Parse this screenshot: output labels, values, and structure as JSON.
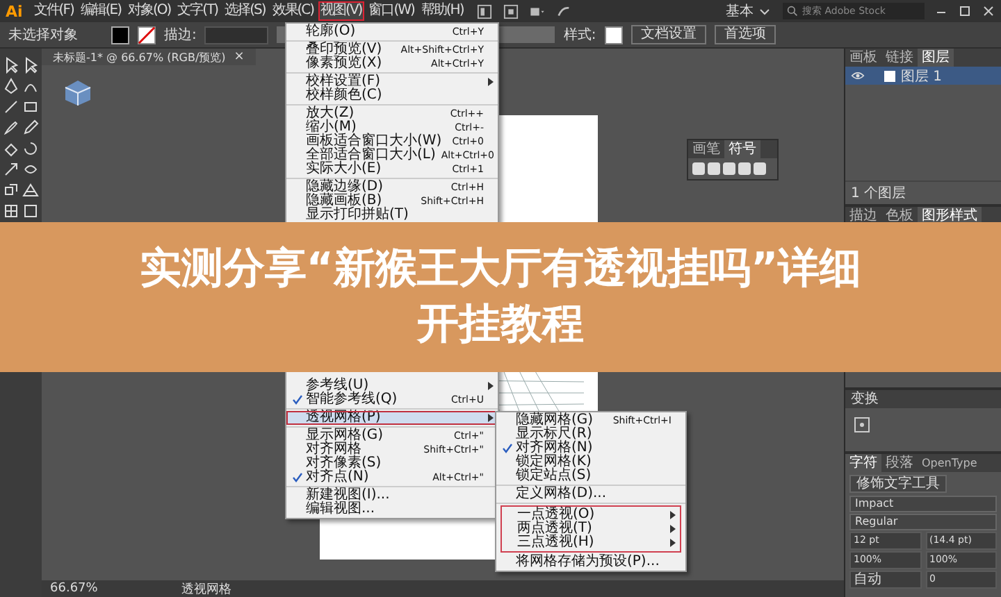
{
  "app": {
    "logo": "Ai"
  },
  "menubar": {
    "items": [
      {
        "label": "文件(F)",
        "selected": false
      },
      {
        "label": "编辑(E)",
        "selected": false
      },
      {
        "label": "对象(O)",
        "selected": false
      },
      {
        "label": "文字(T)",
        "selected": false
      },
      {
        "label": "选择(S)",
        "selected": false
      },
      {
        "label": "效果(C)",
        "selected": false
      },
      {
        "label": "视图(V)",
        "selected": true
      },
      {
        "label": "窗口(W)",
        "selected": false
      },
      {
        "label": "帮助(H)",
        "selected": false
      }
    ],
    "workspace": "基本",
    "search": {
      "placeholder": "搜索 Adobe Stock"
    }
  },
  "control_bar": {
    "selection": "未选择对象",
    "stroke_label": "描边:",
    "style_label": "样式:",
    "buttons": [
      "文档设置",
      "首选项"
    ]
  },
  "document_tab": {
    "title": "未标题-1* @ 66.67% (RGB/预览)",
    "close": "×"
  },
  "view_menu": {
    "top_groups": [
      {
        "items": [
          {
            "label": "轮廓(O)",
            "shortcut": "Ctrl+Y",
            "submenu": false,
            "checked": false,
            "selected": false
          }
        ]
      },
      {
        "items": [
          {
            "label": "叠印预览(V)",
            "shortcut": "Alt+Shift+Ctrl+Y",
            "submenu": false,
            "checked": false,
            "selected": false
          },
          {
            "label": "像素预览(X)",
            "shortcut": "Alt+Ctrl+Y",
            "submenu": false,
            "checked": false,
            "selected": false
          }
        ]
      },
      {
        "items": [
          {
            "label": "校样设置(F)",
            "submenu": true,
            "checked": false,
            "selected": false
          },
          {
            "label": "校样颜色(C)",
            "submenu": false,
            "checked": false,
            "selected": false
          }
        ]
      },
      {
        "items": [
          {
            "label": "放大(Z)",
            "shortcut": "Ctrl++",
            "submenu": false,
            "checked": false,
            "selected": false
          },
          {
            "label": "缩小(M)",
            "shortcut": "Ctrl+-",
            "submenu": false,
            "checked": false,
            "selected": false
          },
          {
            "label": "画板适合窗口大小(W)",
            "shortcut": "Ctrl+0",
            "submenu": false,
            "checked": false,
            "selected": false
          },
          {
            "label": "全部适合窗口大小(L)",
            "shortcut": "Alt+Ctrl+0",
            "submenu": false,
            "checked": false,
            "selected": false
          },
          {
            "label": "实际大小(E)",
            "shortcut": "Ctrl+1",
            "submenu": false,
            "checked": false,
            "selected": false
          }
        ]
      },
      {
        "items": [
          {
            "label": "隐藏边缘(D)",
            "shortcut": "Ctrl+H",
            "submenu": false,
            "checked": false,
            "selected": false
          },
          {
            "label": "隐藏画板(B)",
            "shortcut": "Shift+Ctrl+H",
            "submenu": false,
            "checked": false,
            "selected": false
          },
          {
            "label": "显示打印拼贴(T)",
            "submenu": false,
            "checked": false,
            "selected": false
          }
        ]
      }
    ],
    "bottom_groups": [
      {
        "items": [
          {
            "label": "参考线(U)",
            "submenu": true,
            "checked": false,
            "selected": false
          },
          {
            "label": "智能参考线(Q)",
            "shortcut": "Ctrl+U",
            "submenu": false,
            "checked": true,
            "selected": false
          }
        ]
      },
      {
        "items": [
          {
            "label": "透视网格(P)",
            "submenu": true,
            "checked": false,
            "selected": true
          }
        ]
      },
      {
        "items": [
          {
            "label": "显示网格(G)",
            "shortcut": "Ctrl+\"",
            "submenu": false,
            "checked": false,
            "selected": false
          },
          {
            "label": "对齐网格",
            "shortcut": "Shift+Ctrl+\"",
            "submenu": false,
            "checked": false,
            "selected": false
          },
          {
            "label": "对齐像素(S)",
            "submenu": false,
            "checked": false,
            "selected": false
          },
          {
            "label": "对齐点(N)",
            "shortcut": "Alt+Ctrl+\"",
            "submenu": false,
            "checked": true,
            "selected": false
          }
        ]
      },
      {
        "items": [
          {
            "label": "新建视图(I)...",
            "submenu": false,
            "checked": false,
            "selected": false
          },
          {
            "label": "编辑视图...",
            "submenu": false,
            "checked": false,
            "selected": false
          }
        ]
      }
    ]
  },
  "perspective_submenu": {
    "groups": [
      {
        "outlined": false,
        "items": [
          {
            "label": "隐藏网格(G)",
            "shortcut": "Shift+Ctrl+I",
            "submenu": false,
            "checked": false
          },
          {
            "label": "显示标尺(R)",
            "submenu": false,
            "checked": false
          },
          {
            "label": "对齐网格(N)",
            "submenu": false,
            "checked": true
          },
          {
            "label": "锁定网格(K)",
            "submenu": false,
            "checked": false
          },
          {
            "label": "锁定站点(S)",
            "submenu": false,
            "checked": false
          }
        ]
      },
      {
        "outlined": false,
        "items": [
          {
            "label": "定义网格(D)...",
            "submenu": false,
            "checked": false
          }
        ]
      },
      {
        "outlined": true,
        "items": [
          {
            "label": "一点透视(O)",
            "submenu": true,
            "checked": false
          },
          {
            "label": "两点透视(T)",
            "submenu": true,
            "checked": false
          },
          {
            "label": "三点透视(H)",
            "submenu": true,
            "checked": false
          }
        ]
      },
      {
        "outlined": false,
        "items": [
          {
            "label": "将网格存储为预设(P)...",
            "submenu": false,
            "checked": false
          }
        ]
      }
    ]
  },
  "symbols_panel": {
    "tabs": [
      {
        "label": "画笔",
        "selected": false
      },
      {
        "label": "符号",
        "selected": true
      }
    ]
  },
  "layers_panel": {
    "tabs": [
      {
        "label": "画板",
        "selected": false
      },
      {
        "label": "链接",
        "selected": false
      },
      {
        "label": "图层",
        "selected": true
      }
    ],
    "layers": [
      {
        "name": "图层 1",
        "selected": true
      }
    ],
    "footer": "1 个图层"
  },
  "styles_panel": {
    "tabs": [
      {
        "label": "描边",
        "selected": false
      },
      {
        "label": "色板",
        "selected": false
      },
      {
        "label": "图形样式",
        "selected": true
      }
    ]
  },
  "transform_panel": {
    "title": "变换"
  },
  "character_panel": {
    "tabs": [
      {
        "label": "字符",
        "selected": true
      },
      {
        "label": "段落",
        "selected": false
      },
      {
        "label": "OpenType",
        "selected": false
      }
    ],
    "touch_tool": "修饰文字工具",
    "font": "Impact",
    "style": "Regular",
    "size": "12 pt",
    "leading": "(14.4 pt)",
    "vscale": "100%",
    "hscale": "100%",
    "kerning": "自动",
    "tracking": "0"
  },
  "status_bar": {
    "zoom": "66.67%",
    "tool": "透视网格"
  },
  "banner": {
    "lines": [
      "实测分享“新猴王大厅有透视挂吗”详细",
      "开挂教程"
    ]
  }
}
